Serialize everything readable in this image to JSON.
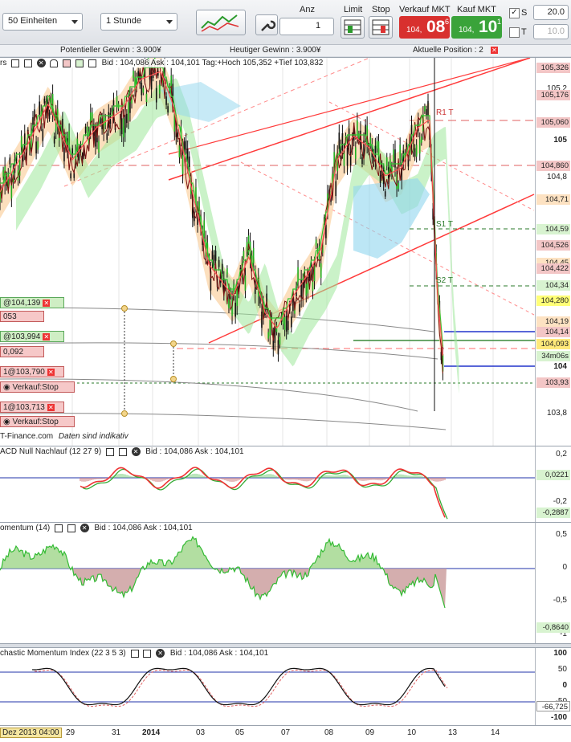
{
  "toolbar": {
    "units_value": "50 Einheiten",
    "interval_value": "1 Stunde",
    "anz_label": "Anz",
    "anz_value": "1",
    "limit_label": "Limit",
    "stop_label": "Stop",
    "sell_label": "Verkauf MKT",
    "sell_small": "104,",
    "sell_big": "08",
    "sell_sup": "6",
    "buy_label": "Kauf MKT",
    "buy_small": "104,",
    "buy_big": "10",
    "buy_sup": "1",
    "s_label": "S",
    "s_value": "20.0",
    "t_label": "T",
    "t_value": "10.0"
  },
  "info": {
    "potential": "Potentieller Gewinn : 3.900¥",
    "today": "Heutiger Gewinn : 3.900¥",
    "position": "Aktuelle Position : 2"
  },
  "main_chart": {
    "title_prefix": "rs",
    "title_text": "Bid : 104,086 Ask : 104,101 Tag:+Hoch 105,352 +Tief 103,832",
    "source": "T-Finance.com",
    "indicative": "Daten sind indikativ",
    "y_ticks": [
      "105,2",
      "105",
      "104,8",
      "104",
      "103,8"
    ],
    "price_boxes": [
      {
        "label": "105,326",
        "bg": "#f3c6c6"
      },
      {
        "label": "105,176",
        "bg": "#f3c6c6"
      },
      {
        "label": "105,060",
        "bg": "#f3c6c6"
      },
      {
        "label": "104,860",
        "bg": "#f3c6c6"
      },
      {
        "label": "104,71",
        "bg": "#fde2c2"
      },
      {
        "label": "104,59",
        "bg": "#d8f3d0"
      },
      {
        "label": "104,526",
        "bg": "#f3c6c6"
      },
      {
        "label": "104,45",
        "bg": "#fde2c2"
      },
      {
        "label": "104,422",
        "bg": "#f3c6c6"
      },
      {
        "label": "104,34",
        "bg": "#d8f3d0"
      },
      {
        "label": "104,280",
        "bg": "#ffff77"
      },
      {
        "label": "104,19",
        "bg": "#fde2c2"
      },
      {
        "label": "104,14",
        "bg": "#f3c6c6"
      },
      {
        "label": "104,093",
        "bg": "#ffe97a"
      },
      {
        "label": "34m06s",
        "bg": "#d8f3d0"
      },
      {
        "label": "103,93",
        "bg": "#f3c6c6"
      }
    ],
    "pivot_labels": [
      "R1 T",
      "S1 T",
      "S2 T"
    ],
    "orders": [
      {
        "label": "@104,139",
        "kind": "buy"
      },
      {
        "label": "053",
        "kind": "sell"
      },
      {
        "label": "@103,994",
        "kind": "buy"
      },
      {
        "label": "0,092",
        "kind": "sell"
      },
      {
        "label": "1@103,790",
        "kind": "sell"
      },
      {
        "label": "Verkauf:Stop",
        "kind": "stop"
      },
      {
        "label": "1@103,713",
        "kind": "sell"
      },
      {
        "label": "Verkauf:Stop",
        "kind": "stop"
      }
    ]
  },
  "macd": {
    "title": "ACD Null Nachlauf (12 27 9)",
    "quote": "Bid : 104,086 Ask : 104,101",
    "y_ticks": [
      "0,2",
      "-0,2"
    ],
    "boxes": [
      {
        "label": "0,0221",
        "bg": "#d8f3d0"
      },
      {
        "label": "-0,2887",
        "bg": "#d8f3d0"
      }
    ]
  },
  "momentum": {
    "title": "omentum (14)",
    "quote": "Bid : 104,086 Ask : 104,101",
    "y_ticks": [
      "0,5",
      "0",
      "-0,5",
      "-1"
    ],
    "boxes": [
      {
        "label": "-0,8640",
        "bg": "#d8f3d0"
      }
    ]
  },
  "smi": {
    "title": "chastic Momentum Index (22 3 5 3)",
    "quote": "Bid : 104,086 Ask : 104,101",
    "y_ticks": [
      "100",
      "50",
      "0",
      "-50",
      "-100"
    ],
    "boxes": [
      {
        "label": "-66,725",
        "bg": "#ffffff"
      }
    ]
  },
  "x_axis": {
    "current": "Dez 2013 04:00",
    "labels": [
      "29",
      "31",
      "2014",
      "03",
      "05",
      "07",
      "08",
      "09",
      "10",
      "13",
      "14"
    ]
  }
}
